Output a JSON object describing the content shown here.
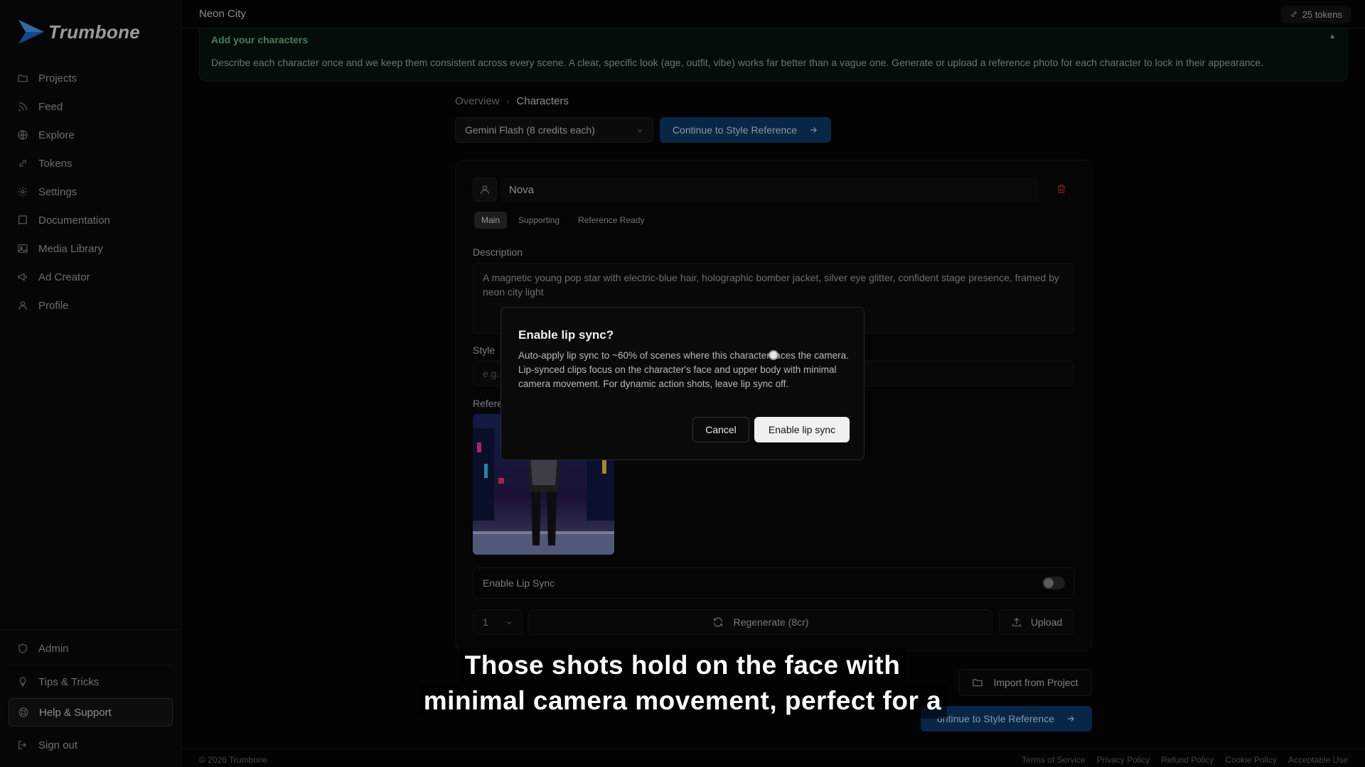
{
  "app": {
    "name": "Trumbone"
  },
  "sidebar": {
    "items": [
      {
        "label": "Projects",
        "icon": "folder-icon"
      },
      {
        "label": "Feed",
        "icon": "rss-icon"
      },
      {
        "label": "Explore",
        "icon": "globe-icon"
      },
      {
        "label": "Tokens",
        "icon": "link-icon"
      },
      {
        "label": "Settings",
        "icon": "gear-icon"
      },
      {
        "label": "Documentation",
        "icon": "book-icon"
      },
      {
        "label": "Media Library",
        "icon": "image-icon"
      },
      {
        "label": "Ad Creator",
        "icon": "megaphone-icon"
      },
      {
        "label": "Profile",
        "icon": "user-icon"
      }
    ],
    "bottom": {
      "admin": "Admin",
      "tips": "Tips & Tricks",
      "help": "Help & Support",
      "signout": "Sign out"
    }
  },
  "topbar": {
    "project_title": "Neon City",
    "tokens": "25 tokens"
  },
  "banner": {
    "title": "Add your characters",
    "text": "Describe each character once and we keep them consistent across every scene. A clear, specific look (age, outfit, vibe) works far better than a vague one. Generate or upload a reference photo for each character to lock in their appearance."
  },
  "breadcrumb": {
    "parent": "Overview",
    "current": "Characters"
  },
  "toolbar": {
    "model": "Gemini Flash (8 credits each)",
    "continue_label": "Continue to Style Reference"
  },
  "character": {
    "name": "Nova",
    "chips": [
      "Main",
      "Supporting",
      "Reference Ready"
    ],
    "description_label": "Description",
    "description": "A magnetic young pop star with electric-blue hair, holographic bomber jacket, silver eye glitter, confident stage presence, framed by neon city light",
    "style_label": "Style",
    "style_placeholder": "e.g.",
    "reference_label": "Refere",
    "lip_sync_label": "Enable Lip Sync",
    "lip_sync_enabled": false,
    "count": "1",
    "regenerate_label": "Regenerate (8cr)",
    "upload_label": "Upload"
  },
  "actions": {
    "import_label": "Import from Project",
    "continue_label": "ontinue to Style Reference"
  },
  "modal": {
    "title": "Enable lip sync?",
    "text": "Auto-apply lip sync to ~60% of scenes where this character faces the camera. Lip-synced clips focus on the character's face and upper body with minimal camera movement. For dynamic action shots, leave lip sync off.",
    "cancel_label": "Cancel",
    "confirm_label": "Enable lip sync"
  },
  "caption": {
    "line1": "Those shots hold on the face with",
    "line2": "minimal camera movement, perfect for a"
  },
  "footer": {
    "copyright": "© 2026 Trumbone",
    "links": [
      "Terms of Service",
      "Privacy Policy",
      "Refund Policy",
      "Cookie Policy",
      "Acceptable Use"
    ]
  },
  "colors": {
    "accent": "#0d3b6e",
    "banner_title": "#6fbf95",
    "danger": "#c23a3a"
  }
}
